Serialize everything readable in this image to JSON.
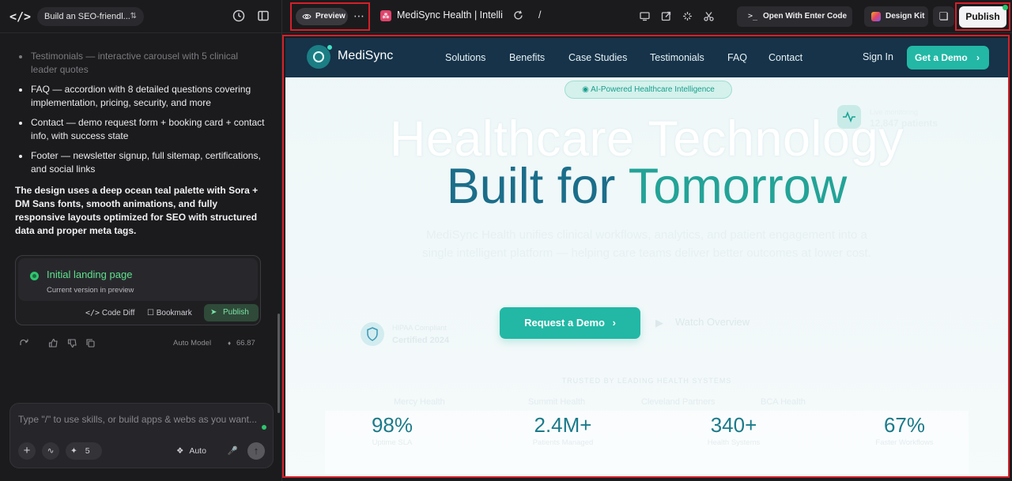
{
  "topbar": {
    "project_name": "Build an SEO-friendl...",
    "preview_label": "Preview",
    "more_label": "⋯",
    "page_title": "MediSync Health | Intelli...",
    "url_path": "/",
    "open_with_label": "Open With Enter Code",
    "design_kit_label": "Design Kit",
    "publish_label": "Publish"
  },
  "chat": {
    "bullets": [
      {
        "text": "Testimonials — interactive carousel with 5 clinical leader quotes",
        "faded": true
      },
      {
        "text": "FAQ — accordion with 8 detailed questions covering implementation, pricing, security, and more"
      },
      {
        "text": "Contact — demo request form + booking card + contact info, with success state"
      },
      {
        "text": "Footer — newsletter signup, full sitemap, certifications, and social links"
      }
    ],
    "summary": "The design uses a deep ocean teal palette with Sora + DM Sans fonts, smooth animations, and fully responsive layouts optimized for SEO with structured data and proper meta tags.",
    "version": {
      "title": "Initial landing page",
      "subtitle": "Current version in preview",
      "code_diff_label": "Code Diff",
      "bookmark_label": "Bookmark",
      "publish_label": "Publish"
    },
    "model_label": "Auto Model",
    "credits": "66.87",
    "composer": {
      "placeholder": "Type \"/\" to use skills, or build apps & webs as you want...",
      "skills_count": "5",
      "auto_label": "Auto"
    }
  },
  "site": {
    "brand": "MediSync",
    "nav": [
      "Solutions",
      "Benefits",
      "Case Studies",
      "Testimonials",
      "FAQ",
      "Contact"
    ],
    "sign_in": "Sign In",
    "get_demo": "Get a Demo",
    "badge": "AI-Powered Healthcare Intelligence",
    "headline_1": "Healthcare Technology",
    "headline_2a": "Built for ",
    "headline_2b": "Tomorrow",
    "subhead": "MediSync Health unifies clinical workflows, analytics, and patient engagement into a single intelligent platform — helping care teams deliver better outcomes at lower cost.",
    "float_label": "Live monitoring",
    "float_value": "12,847 patients",
    "shield_label": "HIPAA Compliant",
    "shield_value": "Certified 2024",
    "cta": "Request a Demo",
    "watch": "Watch Overview",
    "trusted": "TRUSTED BY LEADING HEALTH SYSTEMS",
    "logos": [
      "Mercy Health",
      "Summit Health",
      "Cleveland Partners",
      "BCA Health"
    ],
    "stats": [
      {
        "value": "98%",
        "label": "Uptime SLA"
      },
      {
        "value": "2.4M+",
        "label": "Patients Managed"
      },
      {
        "value": "340+",
        "label": "Health Systems"
      },
      {
        "value": "67%",
        "label": "Faster Workflows"
      }
    ]
  },
  "colors": {
    "accent": "#22b8a5",
    "nav_bg": "#163349",
    "highlight_border": "#d3202a",
    "success": "#2fc46f"
  }
}
